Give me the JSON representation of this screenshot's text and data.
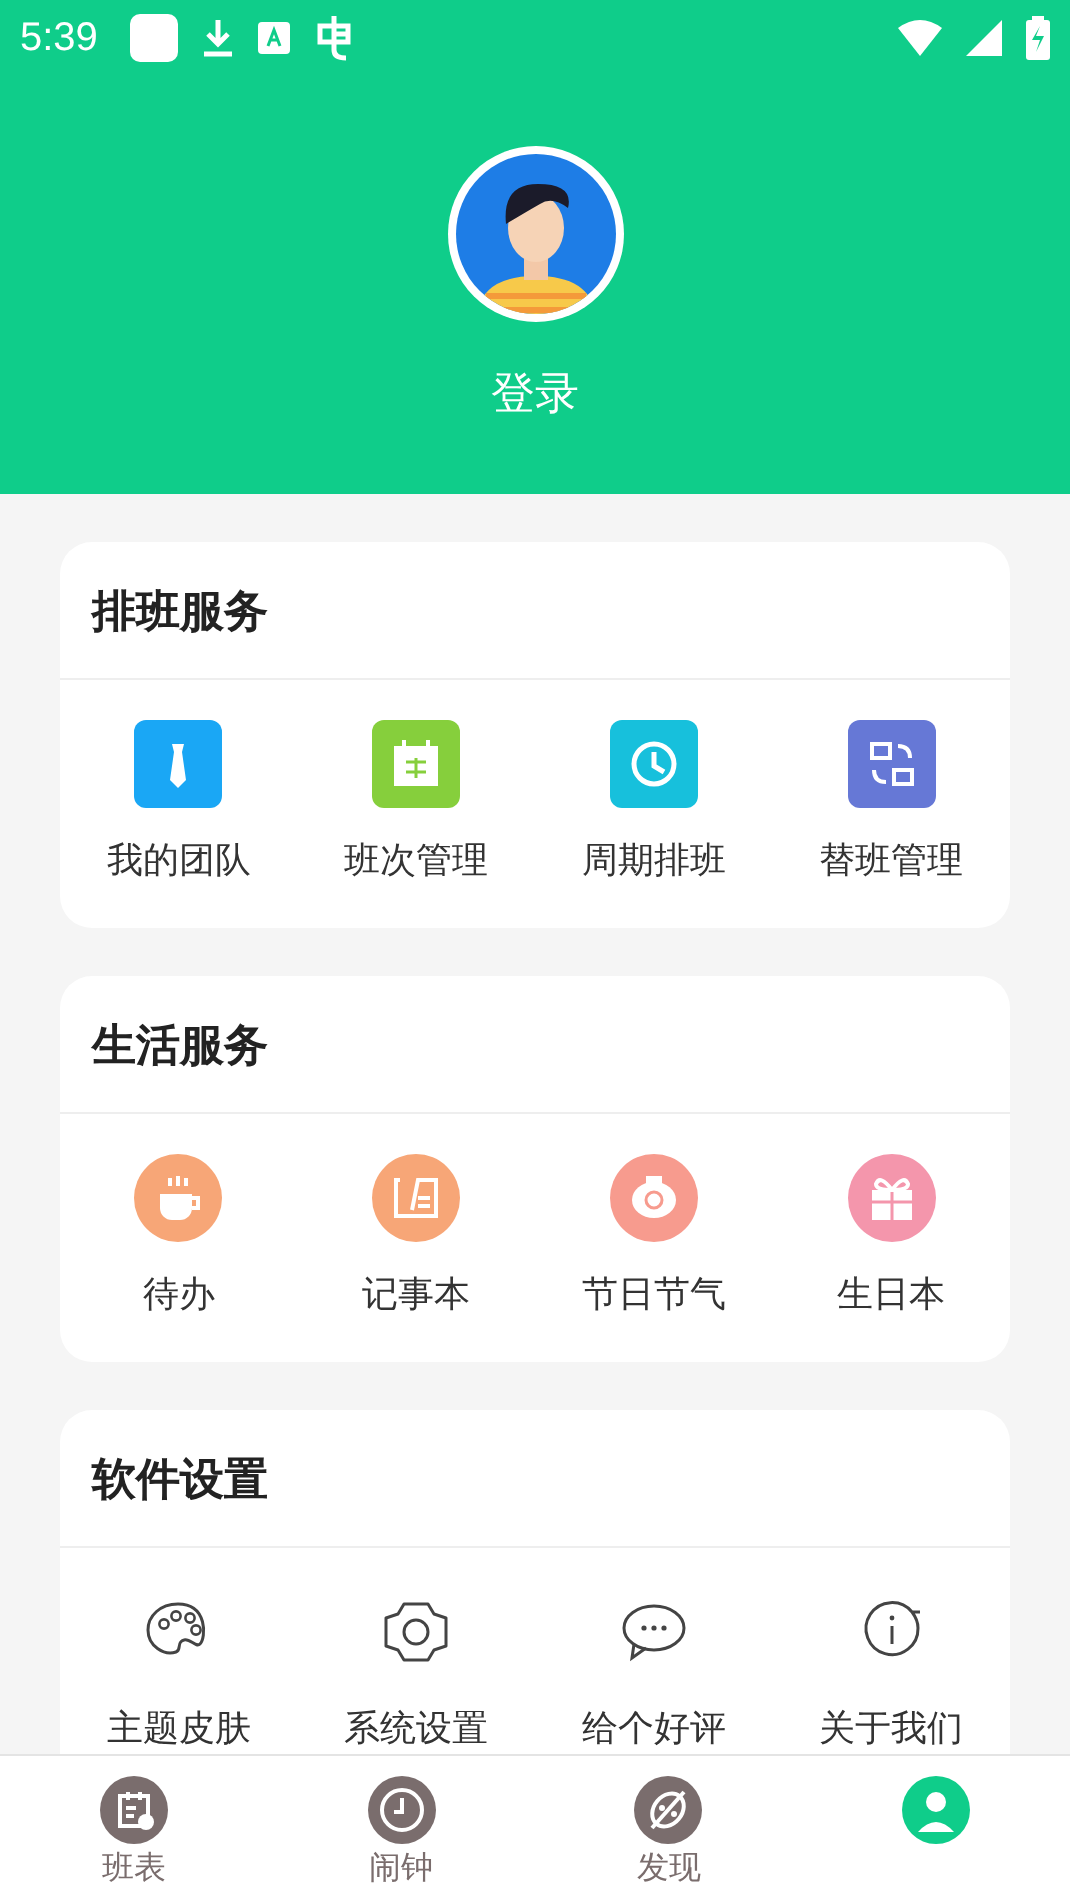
{
  "status_bar": {
    "time": "5:39"
  },
  "profile": {
    "login_label": "登录"
  },
  "sections": [
    {
      "title": "排班服务",
      "items": [
        {
          "label": "我的团队",
          "kind": "tie",
          "color": "#1aa7f5"
        },
        {
          "label": "班次管理",
          "kind": "calendar",
          "color": "#86cf3c"
        },
        {
          "label": "周期排班",
          "kind": "clock",
          "color": "#17c0dc"
        },
        {
          "label": "替班管理",
          "kind": "swap",
          "color": "#6678d6"
        }
      ]
    },
    {
      "title": "生活服务",
      "items": [
        {
          "label": "待办",
          "kind": "cup",
          "color": "#f7a677"
        },
        {
          "label": "记事本",
          "kind": "note",
          "color": "#f7a677"
        },
        {
          "label": "节日节气",
          "kind": "lantern",
          "color": "#f79b8e"
        },
        {
          "label": "生日本",
          "kind": "gift",
          "color": "#f496ac"
        }
      ]
    },
    {
      "title": "软件设置",
      "items": [
        {
          "label": "主题皮肤",
          "kind": "palette"
        },
        {
          "label": "系统设置",
          "kind": "gear"
        },
        {
          "label": "给个好评",
          "kind": "chat"
        },
        {
          "label": "关于我们",
          "kind": "info"
        }
      ]
    }
  ],
  "tabs": [
    {
      "label": "班表",
      "kind": "schedule",
      "selected": false
    },
    {
      "label": "闹钟",
      "kind": "clock",
      "selected": false
    },
    {
      "label": "发现",
      "kind": "discover",
      "selected": false
    },
    {
      "kind": "profile",
      "selected": true
    }
  ]
}
